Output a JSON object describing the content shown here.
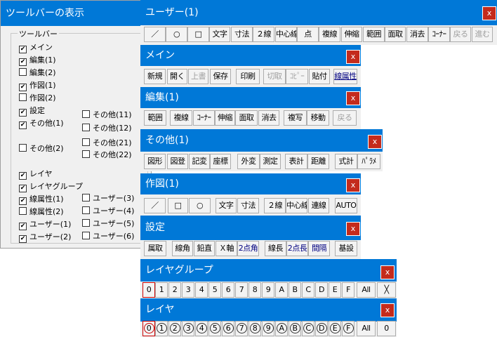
{
  "settings_window": {
    "title": "ツールバーの表示",
    "group_label": "ツールバー",
    "checkboxes": [
      {
        "label": "メイン",
        "checked": true
      },
      {
        "label": "編集(1)",
        "checked": true
      },
      {
        "label": "編集(2)",
        "checked": false
      },
      {
        "label": "作図(1)",
        "checked": true
      },
      {
        "label": "作図(2)",
        "checked": false
      },
      {
        "label": "設定",
        "checked": true
      },
      {
        "label": "その他(1)",
        "checked": true
      },
      {
        "label": "その他(11)",
        "checked": false
      },
      {
        "label": "その他(12)",
        "checked": false
      },
      {
        "label": "その他(2)",
        "checked": false
      },
      {
        "label": "その他(21)",
        "checked": false
      },
      {
        "label": "その他(22)",
        "checked": false
      },
      {
        "label": "レイヤ",
        "checked": true
      },
      {
        "label": "レイヤグループ",
        "checked": true
      },
      {
        "label": "線属性(1)",
        "checked": true
      },
      {
        "label": "ユーザー(3)",
        "checked": false
      },
      {
        "label": "線属性(2)",
        "checked": false
      },
      {
        "label": "ユーザー(4)",
        "checked": false
      },
      {
        "label": "ユーザー(1)",
        "checked": true
      },
      {
        "label": "ユーザー(5)",
        "checked": false
      },
      {
        "label": "ユーザー(2)",
        "checked": true
      },
      {
        "label": "ユーザー(6)",
        "checked": false
      }
    ]
  },
  "close_label": "x",
  "user1": {
    "title": "ユーザー(1)",
    "buttons": [
      "／",
      "○",
      "□",
      "文字",
      "寸法",
      "２線",
      "中心線",
      "点",
      "複線",
      "伸縮",
      "範囲",
      "面取",
      "消去",
      "ｺｰﾅｰ",
      "戻る",
      "進む"
    ]
  },
  "main": {
    "title": "メイン",
    "buttons": [
      "新規",
      "開く",
      "上書",
      "保存",
      "印刷",
      "切取",
      "ｺﾋﾟｰ",
      "貼付",
      "線属性"
    ]
  },
  "edit1": {
    "title": "編集(1)",
    "buttons": [
      "範囲",
      "複線",
      "ｺｰﾅｰ",
      "伸縮",
      "面取",
      "消去",
      "複写",
      "移動",
      "戻る"
    ]
  },
  "other1": {
    "title": "その他(1)",
    "buttons": [
      "図形",
      "図登",
      "記変",
      "座標",
      "外変",
      "測定",
      "表計",
      "距離",
      "式計",
      "ﾊﾟﾗﾒ"
    ]
  },
  "draw1": {
    "title": "作図(1)",
    "buttons": [
      "／",
      "□",
      "○",
      "文字",
      "寸法",
      "２線",
      "中心線",
      "連線",
      "AUTO"
    ]
  },
  "setting": {
    "title": "設定",
    "buttons": [
      "属取",
      "線角",
      "鉛直",
      "Ｘ軸",
      "2点角",
      "線長",
      "2点長",
      "間隔",
      "基設"
    ]
  },
  "layer_group": {
    "title": "レイヤグループ",
    "buttons": [
      "0",
      "1",
      "2",
      "3",
      "4",
      "5",
      "6",
      "7",
      "8",
      "9",
      "A",
      "B",
      "C",
      "D",
      "E",
      "F",
      "All",
      "╳"
    ]
  },
  "layer": {
    "title": "レイヤ",
    "buttons": [
      "0",
      "1",
      "2",
      "3",
      "4",
      "5",
      "6",
      "7",
      "8",
      "9",
      "A",
      "B",
      "C",
      "D",
      "E",
      "F",
      "All",
      "0"
    ]
  }
}
